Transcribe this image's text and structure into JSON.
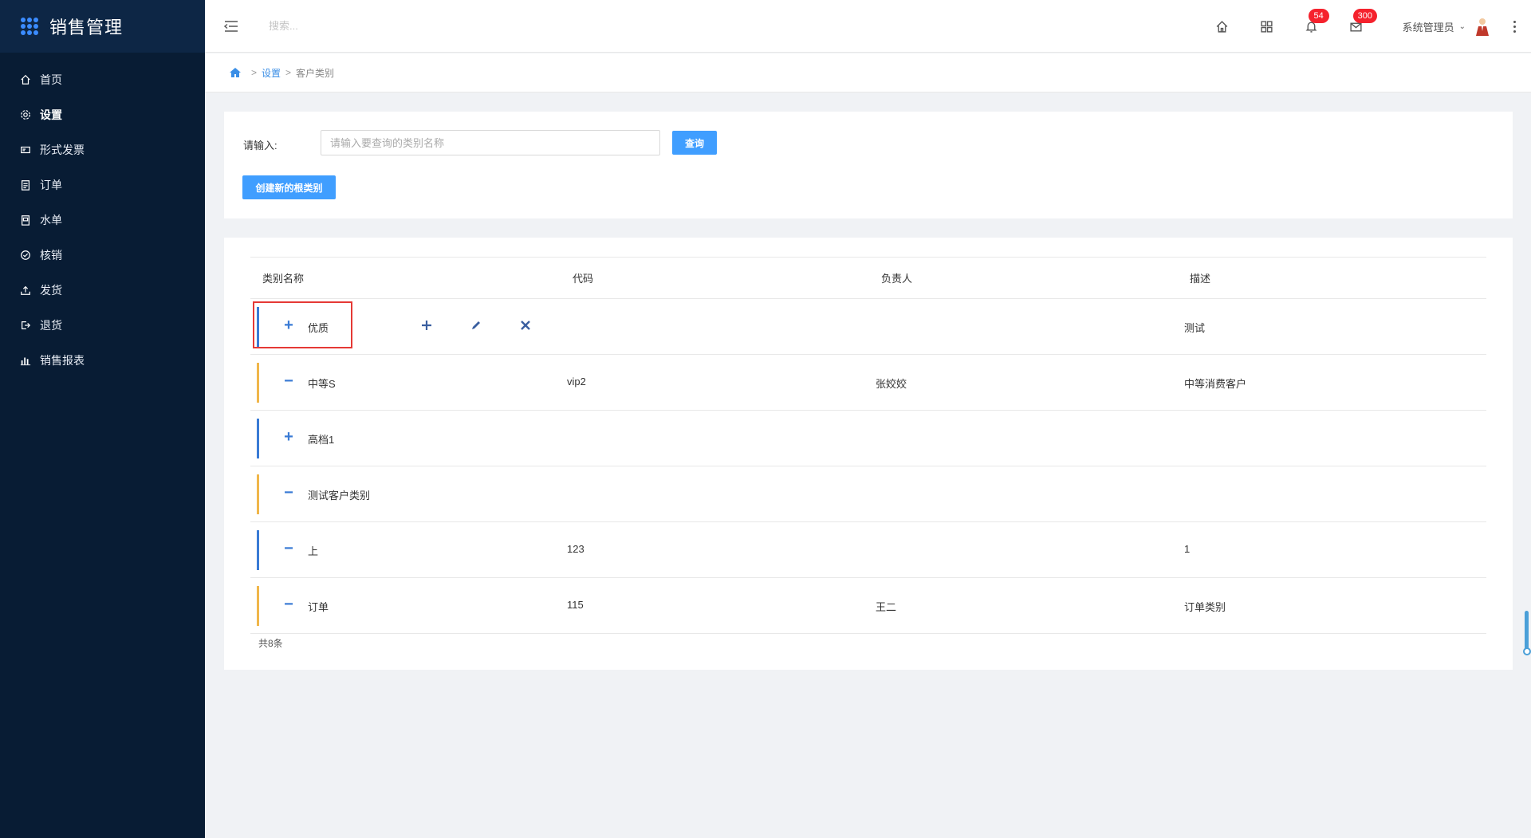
{
  "app": {
    "title": "销售管理"
  },
  "sidebar": {
    "items": [
      {
        "label": "首页",
        "icon": "home-icon"
      },
      {
        "label": "设置",
        "icon": "gear-icon",
        "active": true
      },
      {
        "label": "形式发票",
        "icon": "invoice-icon"
      },
      {
        "label": "订单",
        "icon": "clipboard-icon"
      },
      {
        "label": "水单",
        "icon": "receipt-icon"
      },
      {
        "label": "核销",
        "icon": "check-circle-icon"
      },
      {
        "label": "发货",
        "icon": "upload-icon"
      },
      {
        "label": "退货",
        "icon": "logout-icon"
      },
      {
        "label": "销售报表",
        "icon": "bar-chart-icon"
      }
    ]
  },
  "header": {
    "search_placeholder": "搜索...",
    "notifications_count": "54",
    "messages_count": "300",
    "user_name": "系统管理员"
  },
  "breadcrumb": {
    "items": [
      "设置",
      "客户类别"
    ],
    "separator": ">"
  },
  "query": {
    "label": "请输入:",
    "placeholder": "请输入要查询的类别名称",
    "button": "查询",
    "create_button": "创建新的根类别"
  },
  "table": {
    "headers": [
      "类别名称",
      "代码",
      "负责人",
      "描述"
    ],
    "rows": [
      {
        "toggle": "+",
        "name": "优质",
        "code": "",
        "owner": "",
        "desc": "测试",
        "bar_color": "#3a7bd5",
        "selected": true
      },
      {
        "toggle": "−",
        "name": "中等S",
        "code": "vip2",
        "owner": "张姣姣",
        "desc": "中等消费客户",
        "bar_color": "#f0b64a"
      },
      {
        "toggle": "+",
        "name": "高档1",
        "code": "",
        "owner": "",
        "desc": "",
        "bar_color": "#3a7bd5"
      },
      {
        "toggle": "−",
        "name": "测试客户类别",
        "code": "",
        "owner": "",
        "desc": "",
        "bar_color": "#f0b64a"
      },
      {
        "toggle": "−",
        "name": "上",
        "code": "123",
        "owner": "",
        "desc": "1",
        "bar_color": "#3a7bd5"
      },
      {
        "toggle": "−",
        "name": "订单",
        "code": "115",
        "owner": "王二",
        "desc": "订单类别",
        "bar_color": "#f0b64a"
      }
    ],
    "total": "共8条"
  },
  "colors": {
    "primary": "#409eff",
    "sidebar_bg": "#081c34",
    "highlight": "#e53935"
  }
}
